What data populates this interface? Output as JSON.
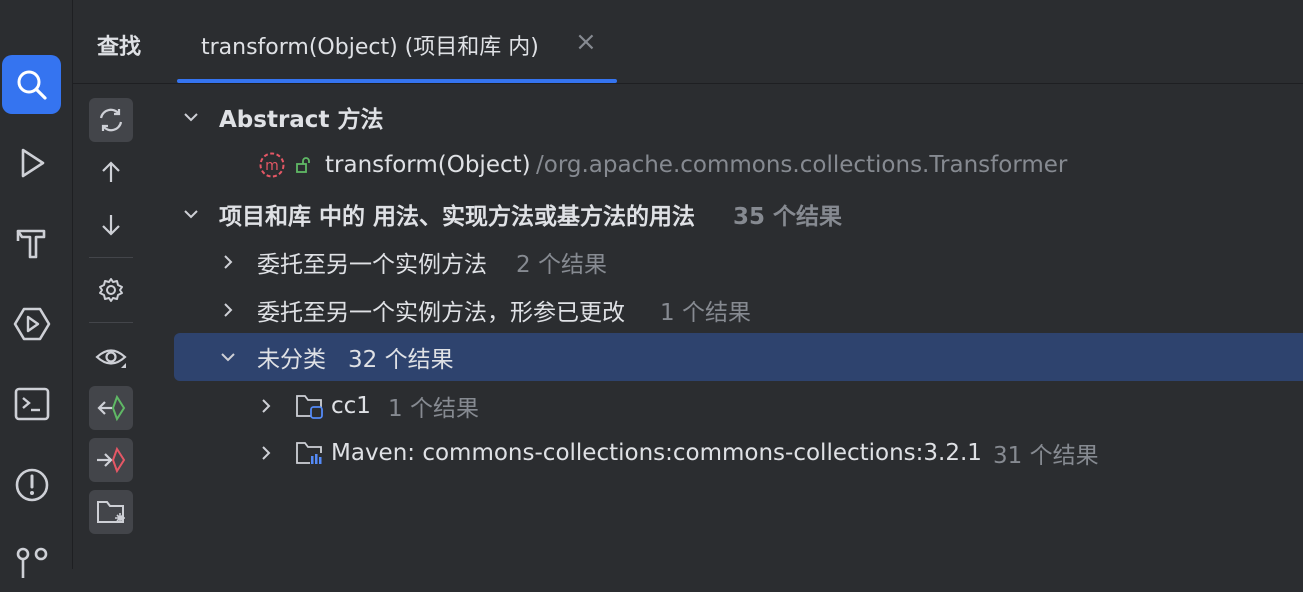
{
  "header": {
    "find_title": "查找",
    "tab_label": "transform(Object) (项目和库 内)",
    "tab_close": "×"
  },
  "strip_icons": [
    "search-icon",
    "run-icon",
    "build-icon",
    "services-icon",
    "terminal-icon",
    "problems-icon",
    "git-icon"
  ],
  "toolbar_icons": [
    "rerun-icon",
    "previous-icon",
    "next-icon",
    "settings-icon",
    "preview-icon",
    "read-access-icon",
    "write-access-icon",
    "group-by-module-icon"
  ],
  "tree": {
    "group1": {
      "label": "Abstract 方法"
    },
    "method": {
      "name": "transform(Object)",
      "path": "/org.apache.commons.collections.Transformer"
    },
    "group2": {
      "label": "项目和库 中的 用法、实现方法或基方法的用法",
      "count": "35 个结果"
    },
    "item1": {
      "label": "委托至另一个实例方法",
      "count": "2 个结果"
    },
    "item2": {
      "label": "委托至另一个实例方法，形参已更改",
      "count": "1 个结果"
    },
    "item3": {
      "label": "未分类",
      "count": "32 个结果"
    },
    "sub1": {
      "label": "cc1",
      "count": "1 个结果"
    },
    "sub2": {
      "label": "Maven: commons-collections:commons-collections:3.2.1",
      "count": "31 个结果"
    }
  },
  "colors": {
    "accent": "#3574f0",
    "selection": "#2e436e",
    "background": "#2b2d30"
  }
}
